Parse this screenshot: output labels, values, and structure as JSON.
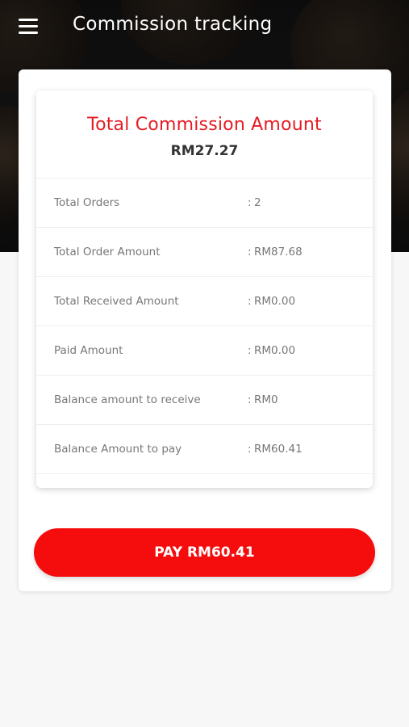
{
  "app_bar": {
    "title": "Commission tracking",
    "menu_icon": "hamburger-menu-icon"
  },
  "colors": {
    "accent": "#e51c23",
    "pay_button": "#f50d0d",
    "background": "#f7f7f7"
  },
  "summary": {
    "title": "Total Commission Amount",
    "total": "RM27.27"
  },
  "details": [
    {
      "label": "Total Orders",
      "separator": ":",
      "value": "2"
    },
    {
      "label": "Total Order Amount",
      "separator": ":",
      "value": "RM87.68"
    },
    {
      "label": "Total Received Amount",
      "separator": ":",
      "value": "RM0.00"
    },
    {
      "label": "Paid Amount",
      "separator": ":",
      "value": "RM0.00"
    },
    {
      "label": "Balance amount to receive",
      "separator": ":",
      "value": "RM0"
    },
    {
      "label": "Balance Amount to pay",
      "separator": ":",
      "value": "RM60.41"
    }
  ],
  "pay_button": {
    "label": "PAY RM60.41"
  }
}
